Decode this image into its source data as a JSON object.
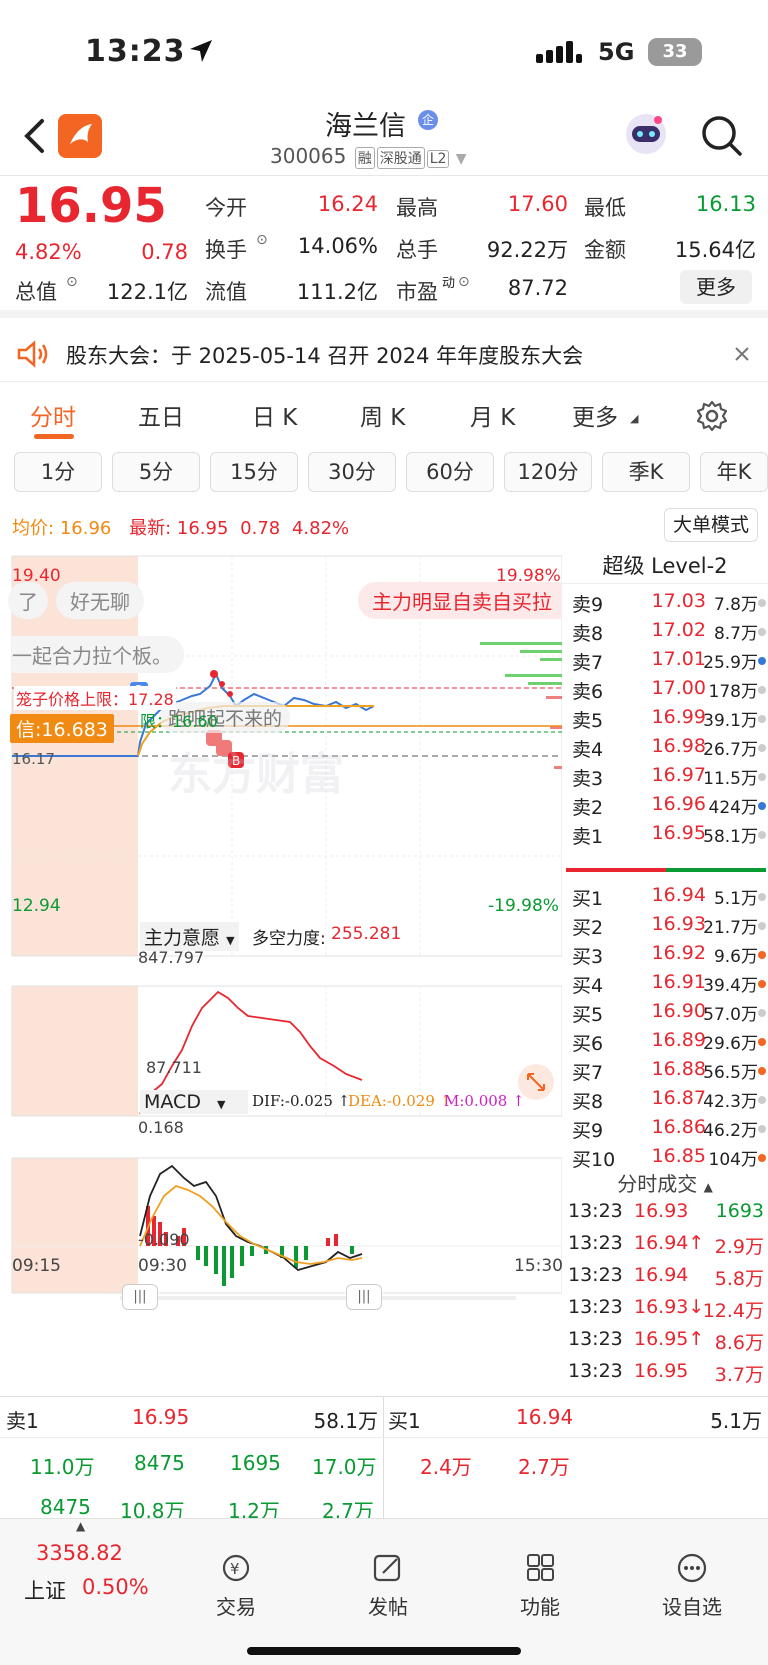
{
  "status": {
    "time": "13:23",
    "network": "5G",
    "battery": "33"
  },
  "header": {
    "name": "海兰信",
    "code": "300065",
    "tags": [
      "融",
      "深股通",
      "L2"
    ]
  },
  "quote": {
    "price": "16.95",
    "pct": "4.82%",
    "change": "0.78",
    "open_lbl": "今开",
    "open": "16.24",
    "high_lbl": "最高",
    "high": "17.60",
    "low_lbl": "最低",
    "low": "16.13",
    "turnover_lbl": "换手",
    "turnover": "14.06%",
    "volume_lbl": "总手",
    "volume": "92.22万",
    "amount_lbl": "金额",
    "amount": "15.64亿",
    "mcap_lbl": "总值",
    "mcap": "122.1亿",
    "float_lbl": "流值",
    "float": "111.2亿",
    "pe_lbl": "市盈",
    "pe_sup": "动",
    "pe": "87.72",
    "more": "更多"
  },
  "notice": {
    "text": "股东大会：于 2025-05-14 召开 2024 年年度股东大会"
  },
  "period_tabs": [
    "分时",
    "五日",
    "日 K",
    "周 K",
    "月 K",
    "更多"
  ],
  "minute_tabs": [
    "1分",
    "5分",
    "15分",
    "30分",
    "60分",
    "120分",
    "季K",
    "年K"
  ],
  "chart": {
    "avg_lbl": "均价:",
    "avg": "16.96",
    "latest_lbl": "最新:",
    "latest": "16.95",
    "latest_chg": "0.78",
    "latest_pct": "4.82%",
    "big_order": "大单模式",
    "y_top": "19.40",
    "y_bottom": "12.94",
    "pct_top": "19.98%",
    "pct_bottom": "-19.98%",
    "prev_close": "16.17",
    "comment1": "了",
    "comment2": "好无聊",
    "comment3": "主力明显自卖自买拉",
    "comment4": "一起合力拉个板。",
    "comment5": "跑吧起不来的",
    "price_limit_lbl": "笼子价格上限：17.28",
    "lower_limit_lbl": "限：16.60",
    "signal_lbl": "信:16.683",
    "watermark": "东方财富",
    "ind1_name": "主力意愿",
    "ind1_val_lbl": "多空力度:",
    "ind1_val": "255.281",
    "ind1_top": "847.797",
    "ind1_bottom": "87.711",
    "macd_name": "MACD",
    "dif": "DIF:-0.025 ↑",
    "dea": "DEA:-0.029 ↑",
    "m": "M:0.008 ↑",
    "macd_top": "0.168",
    "macd_bottom": "-0.090",
    "t0": "09:15",
    "t1": "09:30",
    "t2": "15:30"
  },
  "order_book": {
    "title": "超级 Level-2",
    "asks": [
      {
        "lbl": "卖9",
        "p": "17.03",
        "v": "7.8万"
      },
      {
        "lbl": "卖8",
        "p": "17.02",
        "v": "8.7万"
      },
      {
        "lbl": "卖7",
        "p": "17.01",
        "v": "25.9万"
      },
      {
        "lbl": "卖6",
        "p": "17.00",
        "v": "178万"
      },
      {
        "lbl": "卖5",
        "p": "16.99",
        "v": "39.1万"
      },
      {
        "lbl": "卖4",
        "p": "16.98",
        "v": "26.7万"
      },
      {
        "lbl": "卖3",
        "p": "16.97",
        "v": "11.5万"
      },
      {
        "lbl": "卖2",
        "p": "16.96",
        "v": "424万"
      },
      {
        "lbl": "卖1",
        "p": "16.95",
        "v": "58.1万"
      }
    ],
    "bids": [
      {
        "lbl": "买1",
        "p": "16.94",
        "v": "5.1万"
      },
      {
        "lbl": "买2",
        "p": "16.93",
        "v": "21.7万"
      },
      {
        "lbl": "买3",
        "p": "16.92",
        "v": "9.6万"
      },
      {
        "lbl": "买4",
        "p": "16.91",
        "v": "39.4万"
      },
      {
        "lbl": "买5",
        "p": "16.90",
        "v": "57.0万"
      },
      {
        "lbl": "买6",
        "p": "16.89",
        "v": "29.6万"
      },
      {
        "lbl": "买7",
        "p": "16.88",
        "v": "56.5万"
      },
      {
        "lbl": "买8",
        "p": "16.87",
        "v": "42.3万"
      },
      {
        "lbl": "买9",
        "p": "16.86",
        "v": "46.2万"
      },
      {
        "lbl": "买10",
        "p": "16.85",
        "v": "104万"
      }
    ]
  },
  "ticks": {
    "title": "分时成交",
    "rows": [
      {
        "t": "13:23",
        "p": "16.93",
        "v": "1693"
      },
      {
        "t": "13:23",
        "p": "16.94↑",
        "v": "2.9万"
      },
      {
        "t": "13:23",
        "p": "16.94",
        "v": "5.8万"
      },
      {
        "t": "13:23",
        "p": "16.93↓",
        "v": "12.4万"
      },
      {
        "t": "13:23",
        "p": "16.95↑",
        "v": "8.6万"
      },
      {
        "t": "13:23",
        "p": "16.95",
        "v": "3.7万"
      }
    ]
  },
  "depth": {
    "ask_lbl": "卖1",
    "ask_p": "16.95",
    "ask_v": "58.1万",
    "bid_lbl": "买1",
    "bid_p": "16.94",
    "bid_v": "5.1万",
    "ask_q1": [
      "11.0万",
      "8475",
      "1695",
      "17.0万"
    ],
    "ask_q2": [
      "8475",
      "10.8万",
      "1.2万",
      "2.7万"
    ],
    "bid_q1": [
      "2.4万",
      "2.7万"
    ]
  },
  "bottom_nav": {
    "index_val": "3358.82",
    "index_name": "上证",
    "index_pct": "0.50%",
    "trade": "交易",
    "post": "发帖",
    "func": "功能",
    "watch": "设自选"
  },
  "colors": {
    "up": "#e8262f",
    "down": "#0a9a32",
    "accent": "#f26522",
    "avg": "#f0a020",
    "price_line": "#3a78d8"
  }
}
